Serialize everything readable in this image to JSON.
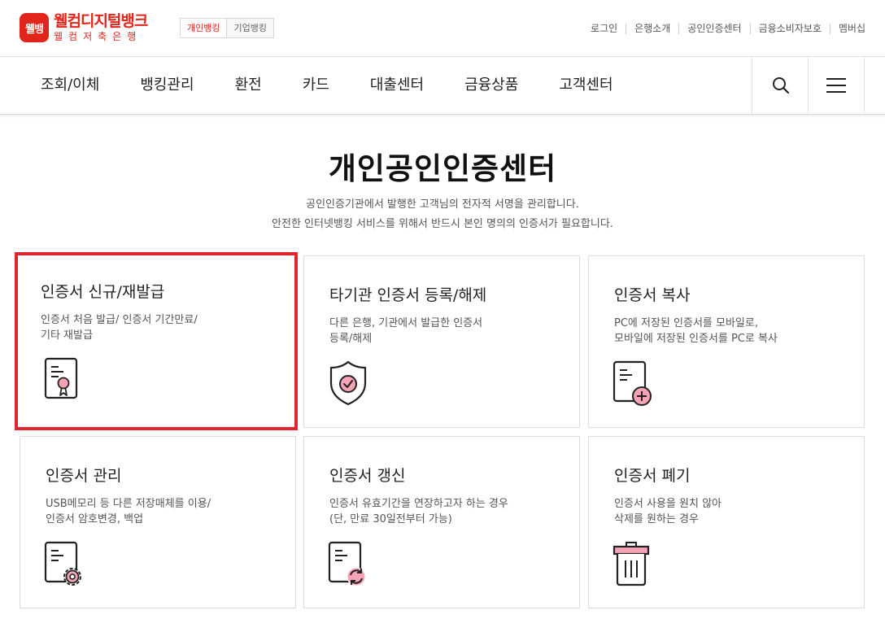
{
  "header": {
    "logo_badge": "웰뱅",
    "logo_name": "웰컴디지털뱅크",
    "logo_sub": "웰컴저축은행",
    "bank_tabs": [
      "개인뱅킹",
      "기업뱅킹"
    ],
    "util_links": [
      "로그인",
      "은행소개",
      "공인인증센터",
      "금융소비자보호",
      "멤버십"
    ]
  },
  "gnb": {
    "items": [
      "조회/이체",
      "뱅킹관리",
      "환전",
      "카드",
      "대출센터",
      "금융상품",
      "고객센터"
    ],
    "search_icon": "search-icon",
    "menu_icon": "hamburger-menu-icon"
  },
  "page": {
    "title": "개인공인인증센터",
    "desc_line1": "공인인증기관에서 발행한 고객님의 전자적 서명을 관리합니다.",
    "desc_line2": "안전한 인터넷뱅킹 서비스를 위해서 반드시 본인 명의의 인증서가 필요합니다."
  },
  "cards": [
    {
      "title": "인증서 신규/재발급",
      "desc": [
        "인증서 처음 발급/ 인증서 기간만료/",
        "기타 재발급"
      ],
      "icon": "certificate-ribbon-icon",
      "selected": true
    },
    {
      "title": "타기관 인증서 등록/해제",
      "desc": [
        "다른 은행, 기관에서 발급한 인증서",
        "등록/해제"
      ],
      "icon": "shield-check-icon"
    },
    {
      "title": "인증서 복사",
      "desc": [
        "PC에 저장된 인증서를 모바일로,",
        "모바일에 저장된 인증서를 PC로 복사"
      ],
      "icon": "document-plus-icon"
    },
    {
      "title": "인증서 관리",
      "desc": [
        "USB메모리 등 다른 저장매체를 이용/",
        "인증서 암호변경, 백업"
      ],
      "icon": "document-gear-icon"
    },
    {
      "title": "인증서 갱신",
      "desc": [
        "인증서 유효기간을 연장하고자 하는 경우",
        "(단, 만료 30일전부터 가능)"
      ],
      "icon": "document-refresh-icon"
    },
    {
      "title": "인증서 폐기",
      "desc": [
        "인증서 사용을 원치 않아",
        "삭제를 원하는 경우"
      ],
      "icon": "trash-icon"
    }
  ],
  "colors": {
    "brand_red": "#e1251b",
    "icon_pink": "#f5a3b5",
    "selection_border": "#e1252f"
  }
}
